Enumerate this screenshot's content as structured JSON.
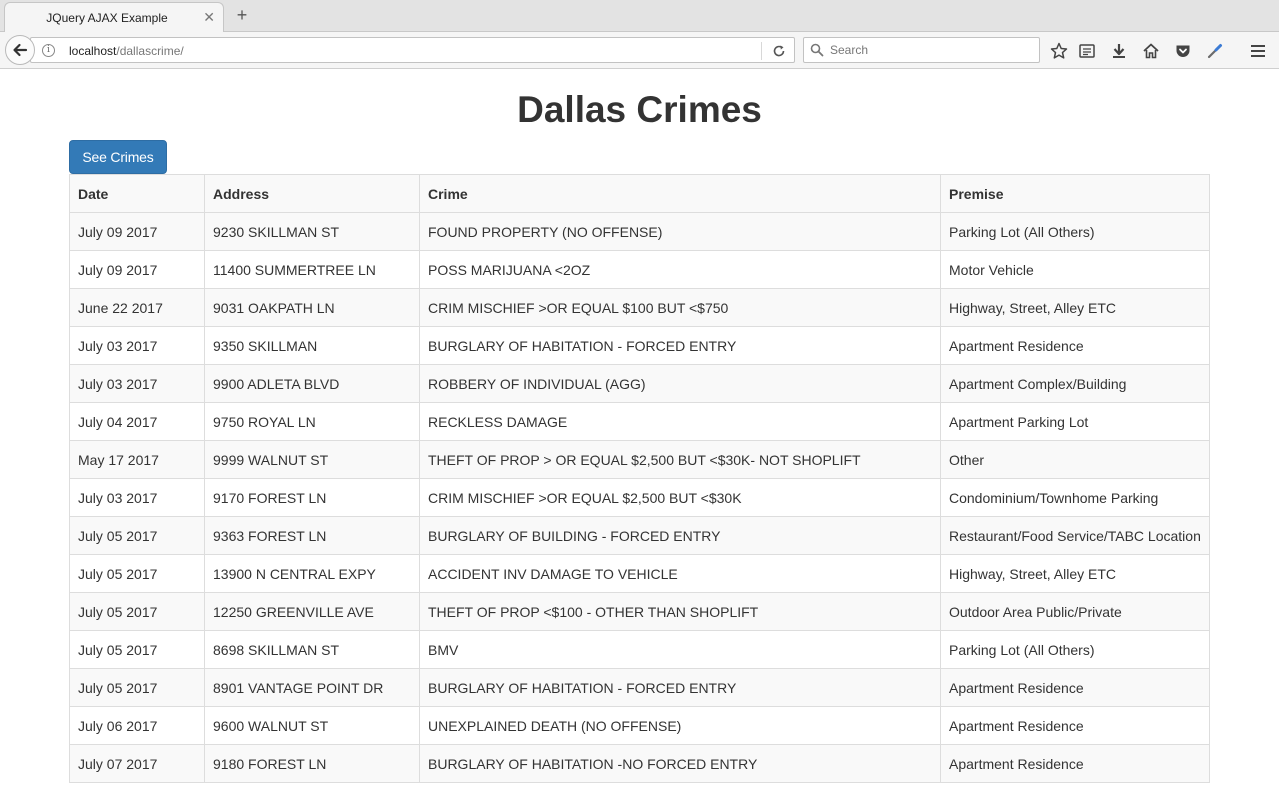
{
  "browser": {
    "tab_title": "JQuery AJAX Example",
    "url_host": "localhost",
    "url_path": "/dallascrime/",
    "search_placeholder": "Search"
  },
  "page": {
    "title": "Dallas Crimes",
    "button_label": "See Crimes"
  },
  "table": {
    "headers": [
      "Date",
      "Address",
      "Crime",
      "Premise"
    ],
    "rows": [
      [
        "July 09 2017",
        "9230 SKILLMAN ST",
        "FOUND PROPERTY (NO OFFENSE)",
        "Parking Lot (All Others)"
      ],
      [
        "July 09 2017",
        "11400 SUMMERTREE LN",
        "POSS MARIJUANA <2OZ",
        "Motor Vehicle"
      ],
      [
        "June 22 2017",
        "9031 OAKPATH LN",
        "CRIM MISCHIEF >OR EQUAL $100 BUT <$750",
        "Highway, Street, Alley ETC"
      ],
      [
        "July 03 2017",
        "9350 SKILLMAN",
        "BURGLARY OF HABITATION - FORCED ENTRY",
        "Apartment Residence"
      ],
      [
        "July 03 2017",
        "9900 ADLETA BLVD",
        "ROBBERY OF INDIVIDUAL (AGG)",
        "Apartment Complex/Building"
      ],
      [
        "July 04 2017",
        "9750 ROYAL LN",
        "RECKLESS DAMAGE",
        "Apartment Parking Lot"
      ],
      [
        "May 17 2017",
        "9999 WALNUT ST",
        "THEFT OF PROP > OR EQUAL $2,500 BUT <$30K- NOT SHOPLIFT",
        "Other"
      ],
      [
        "July 03 2017",
        "9170 FOREST LN",
        "CRIM MISCHIEF >OR EQUAL $2,500 BUT <$30K",
        "Condominium/Townhome Parking"
      ],
      [
        "July 05 2017",
        "9363 FOREST LN",
        "BURGLARY OF BUILDING - FORCED ENTRY",
        "Restaurant/Food Service/TABC Location"
      ],
      [
        "July 05 2017",
        "13900 N CENTRAL EXPY",
        "ACCIDENT INV DAMAGE TO VEHICLE",
        "Highway, Street, Alley ETC"
      ],
      [
        "July 05 2017",
        "12250 GREENVILLE AVE",
        "THEFT OF PROP <$100 - OTHER THAN SHOPLIFT",
        "Outdoor Area Public/Private"
      ],
      [
        "July 05 2017",
        "8698 SKILLMAN ST",
        "BMV",
        "Parking Lot (All Others)"
      ],
      [
        "July 05 2017",
        "8901 VANTAGE POINT DR",
        "BURGLARY OF HABITATION - FORCED ENTRY",
        "Apartment Residence"
      ],
      [
        "July 06 2017",
        "9600 WALNUT ST",
        "UNEXPLAINED DEATH (NO OFFENSE)",
        "Apartment Residence"
      ],
      [
        "July 07 2017",
        "9180 FOREST LN",
        "BURGLARY OF HABITATION -NO FORCED ENTRY",
        "Apartment Residence"
      ]
    ]
  }
}
